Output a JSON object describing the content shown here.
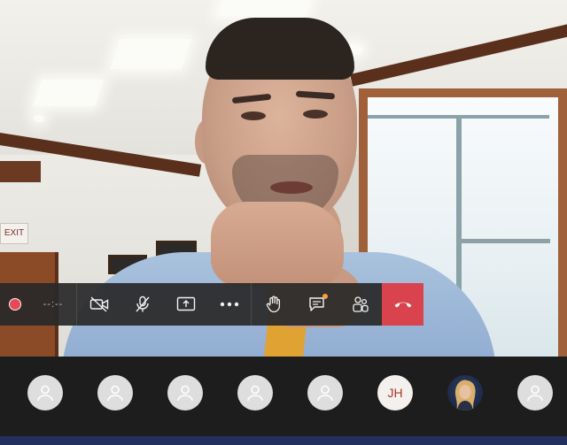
{
  "scene": {
    "exit_sign": "EXIT"
  },
  "toolbar": {
    "recording_timer": "--:--",
    "items": [
      {
        "name": "record-indicator",
        "icon": "record-dot-icon"
      },
      {
        "name": "camera-toggle",
        "icon": "camera-off-icon"
      },
      {
        "name": "mic-toggle",
        "icon": "mic-off-icon"
      },
      {
        "name": "share-screen",
        "icon": "share-screen-icon"
      },
      {
        "name": "more-actions",
        "icon": "more-icon"
      },
      {
        "name": "raise-hand",
        "icon": "hand-icon"
      },
      {
        "name": "chat",
        "icon": "chat-icon"
      },
      {
        "name": "participants",
        "icon": "people-icon"
      },
      {
        "name": "hang-up",
        "icon": "phone-hangup-icon"
      }
    ],
    "colors": {
      "record": "#e74856",
      "hangup": "#d9434e",
      "chat_badge": "#f4a43a",
      "bar": "#292929"
    }
  },
  "participants": [
    {
      "type": "default",
      "icon": "user-icon"
    },
    {
      "type": "default",
      "icon": "user-icon"
    },
    {
      "type": "default",
      "icon": "user-icon"
    },
    {
      "type": "default",
      "icon": "user-icon"
    },
    {
      "type": "default",
      "icon": "user-icon"
    },
    {
      "type": "initials",
      "initials": "JH"
    },
    {
      "type": "photo"
    },
    {
      "type": "default",
      "icon": "user-icon"
    }
  ]
}
